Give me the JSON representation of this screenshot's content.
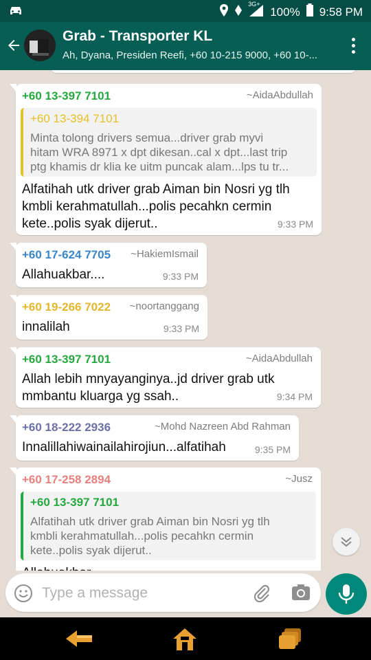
{
  "status_bar": {
    "network": "3G+",
    "battery": "100%",
    "time": "9:58 PM"
  },
  "header": {
    "title": "Grab - Transporter KL",
    "subtitle": "Ah, Dyana, Presiden Reefi, +60 10-215 9000, +60 10-..."
  },
  "messages": [
    {
      "sender": "+60 13-397 7101",
      "sender_color": "#25a83d",
      "alias": "~AidaAbdullah",
      "quote": {
        "sender": "+60 13-394 7101",
        "sender_color": "#e5c028",
        "text_lines": [
          "Minta tolong drivers semua...driver grab myvi",
          "hitam WRA 8971 x dpt dikesan..cal x dpt...last trip",
          "ptg khamis dr klia ke uitm puncak alam...lps tu tr..."
        ]
      },
      "text_lines": [
        "Alfatihah utk driver grab Aiman bin Nosri yg tlh",
        "kmbli kerahmatullah...polis pecahkn cermin",
        "kete..polis syak dijerut.."
      ],
      "time": "9:33 PM"
    },
    {
      "sender": "+60 17-624 7705",
      "sender_color": "#3a85c8",
      "alias": "~HakiemIsmail",
      "text_lines": [
        "Allahuakbar...."
      ],
      "time": "9:33 PM"
    },
    {
      "sender": "+60 19-266 7022",
      "sender_color": "#e2b72d",
      "alias": "~noortanggang",
      "text_lines": [
        "innalilah"
      ],
      "time": "9:33 PM"
    },
    {
      "sender": "+60 13-397 7101",
      "sender_color": "#25a83d",
      "alias": "~AidaAbdullah",
      "text_lines": [
        "Allah lebih mnyayanginya..jd driver grab utk",
        "mmbantu kluarga yg ssah.."
      ],
      "time": "9:34 PM"
    },
    {
      "sender": "+60 18-222 2936",
      "sender_color": "#6b6fa8",
      "alias": "~Mohd Nazreen Abd Rahman",
      "text_lines": [
        "Innalillahiwainailahirojiun...alfatihah"
      ],
      "time": "9:35 PM"
    },
    {
      "sender": "+60 17-258 2894",
      "sender_color": "#e8807d",
      "alias": "~Jusz",
      "quote": {
        "sender": "+60 13-397 7101",
        "sender_color": "#25a83d",
        "text_lines": [
          "Alfatihah utk driver grab Aiman bin Nosri yg tlh",
          "kmbli kerahmatullah...polis pecahkn cermin",
          "kete..polis syak dijerut.."
        ]
      },
      "text_lines": [
        "Allahuakbar..."
      ],
      "time": ""
    }
  ],
  "composer": {
    "placeholder": "Type a message"
  },
  "icons": {
    "status": [
      "car-icon",
      "location-icon",
      "vibrate-icon",
      "signal-icon",
      "battery-icon"
    ],
    "header": [
      "back-arrow-icon",
      "group-avatar",
      "overflow-menu-icon"
    ],
    "composer": [
      "emoji-icon",
      "attach-icon",
      "camera-icon",
      "mic-icon"
    ],
    "nav": [
      "back-nav-icon",
      "home-nav-icon",
      "recents-nav-icon"
    ]
  },
  "colors": {
    "header": "#075e54",
    "status_bar": "#054d44",
    "chat_bg": "#e5ddd5",
    "accent": "#00897b"
  }
}
